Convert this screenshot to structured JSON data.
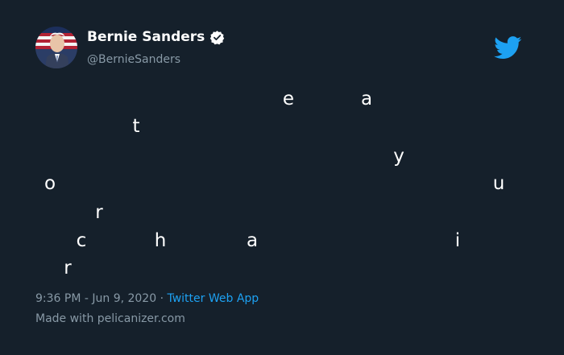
{
  "user": {
    "display_name": "Bernie Sanders",
    "handle": "@BernieSanders",
    "verified": true
  },
  "tweet": {
    "letters": [
      "e",
      "a",
      "t",
      "y",
      "o",
      "u",
      "r",
      "c",
      "h",
      "a",
      "i",
      "r"
    ]
  },
  "meta": {
    "timestamp": "9:36 PM - Jun 9, 2020",
    "separator": " · ",
    "source": "Twitter Web App"
  },
  "footer": {
    "made_with": "Made with pelicanizer.com"
  },
  "colors": {
    "background": "#15202b",
    "text": "#ffffff",
    "muted": "#8899a6",
    "accent": "#1da1f2"
  },
  "icons": {
    "brand": "twitter-bird-icon",
    "verified": "verified-badge-icon"
  }
}
